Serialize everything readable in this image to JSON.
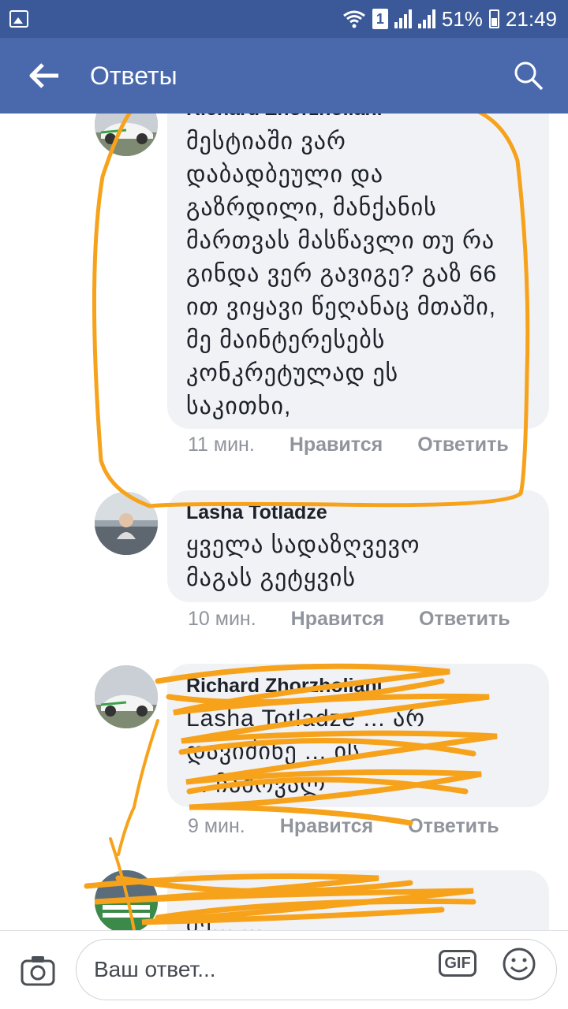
{
  "status_bar": {
    "sim_label": "1",
    "battery": "51%",
    "time": "21:49"
  },
  "app_bar": {
    "title": "Ответы",
    "back_icon": "arrow-left-icon",
    "search_icon": "search-icon"
  },
  "comments": [
    {
      "author": "Richard Zhorzholiani",
      "text": "მესტიაში ვარ\nდაბადბეული და\nგაზრდილი, მანქანის\nმართვას მასწავლი თუ რა\nგინდა ვერ გავიგე? გაზ 66\nით ვიყავი წეღანაც მთაში,\nმე მაინტერესებს\nკონკრეტულად ეს\nსაკითხი,",
      "time": "11 мин.",
      "like": "Нравится",
      "reply": "Ответить"
    },
    {
      "author": "Lasha Totladze",
      "text": "ყველა სადაზღვევო\nმაგას გეტყვის",
      "time": "10 мин.",
      "like": "Нравится",
      "reply": "Ответить"
    },
    {
      "author": "Richard Zhorzholiani",
      "text": "Lasha Totladze ... არ\nდავიძინე ... ის\n... ჩამოვალ",
      "time": "9 мин.",
      "like": "Нравится",
      "reply": "Ответить"
    },
    {
      "author": "...",
      "text": "შე... ...",
      "time": "",
      "like": "",
      "reply": ""
    }
  ],
  "composer": {
    "placeholder": "Ваш ответ...",
    "gif_label": "GIF",
    "camera_icon": "camera-icon",
    "emoji_icon": "smiley-icon"
  },
  "colors": {
    "status_bar": "#3b5998",
    "app_bar": "#4a69ad",
    "bubble": "#f1f2f6",
    "scribble": "#f7a21b",
    "meta": "#90949c"
  }
}
